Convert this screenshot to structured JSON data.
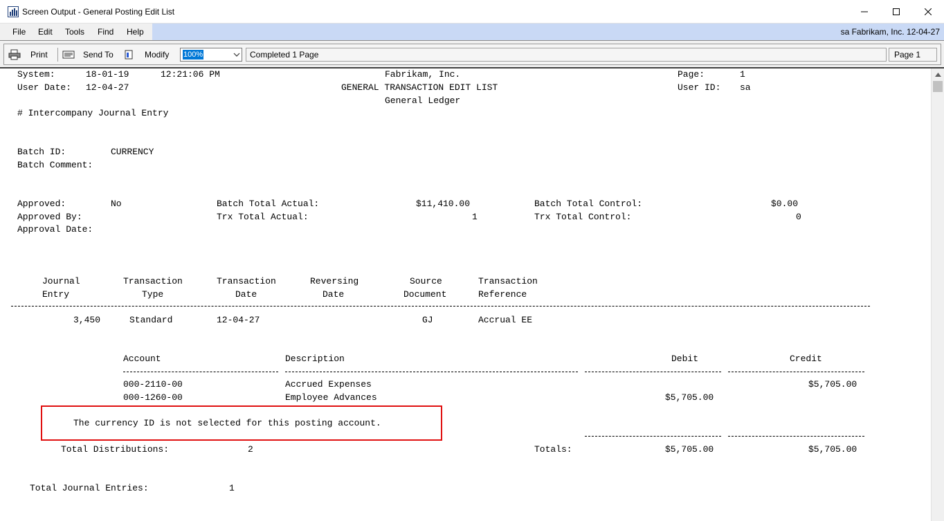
{
  "window": {
    "title": "Screen Output - General Posting Edit List"
  },
  "menu": {
    "items": [
      "File",
      "Edit",
      "Tools",
      "Find",
      "Help"
    ],
    "status": "sa  Fabrikam, Inc.  12-04-27"
  },
  "toolbar": {
    "print": "Print",
    "send_to": "Send To",
    "modify": "Modify",
    "zoom": "100%",
    "status": "Completed 1 Page",
    "page": "Page 1"
  },
  "report": {
    "system_label": "System:",
    "system_date": "18-01-19",
    "system_time": "12:21:06 PM",
    "company": "Fabrikam, Inc.",
    "page_label": "Page:",
    "page_value": "1",
    "user_date_label": "User Date:",
    "user_date": "12-04-27",
    "report_title": "GENERAL TRANSACTION EDIT LIST",
    "user_id_label": "User ID:",
    "user_id": "sa",
    "subtitle": "General Ledger",
    "section_title": "# Intercompany Journal Entry",
    "batch_id_label": "Batch ID:",
    "batch_id": "CURRENCY",
    "batch_comment_label": "Batch Comment:",
    "approved_label": "Approved:",
    "approved": "No",
    "approved_by_label": "Approved By:",
    "approval_date_label": "Approval Date:",
    "batch_total_actual_label": "Batch Total Actual:",
    "batch_total_actual": "$11,410.00",
    "trx_total_actual_label": "Trx Total Actual:",
    "trx_total_actual": "1",
    "batch_total_control_label": "Batch Total Control:",
    "batch_total_control": "$0.00",
    "trx_total_control_label": "Trx Total Control:",
    "trx_total_control": "0",
    "headers": {
      "journal_1": "Journal",
      "journal_2": "Entry",
      "trx_type_1": "Transaction",
      "trx_type_2": "Type",
      "trx_date_1": "Transaction",
      "trx_date_2": "Date",
      "rev_date_1": "Reversing",
      "rev_date_2": "Date",
      "source_1": "Source",
      "source_2": "Document",
      "trx_ref_1": "Transaction",
      "trx_ref_2": "Reference"
    },
    "entry": {
      "journal_entry": "3,450",
      "type": "Standard",
      "date": "12-04-27",
      "source": "GJ",
      "reference": "Accrual EE"
    },
    "dist_headers": {
      "account": "Account",
      "description": "Description",
      "debit": "Debit",
      "credit": "Credit"
    },
    "distributions": [
      {
        "account": "000-2110-00",
        "description": "Accrued Expenses",
        "debit": "",
        "credit": "$5,705.00"
      },
      {
        "account": "000-1260-00",
        "description": "Employee Advances",
        "debit": "$5,705.00",
        "credit": ""
      }
    ],
    "error_message": "The currency ID is not selected for this posting account.",
    "total_distributions_label": "Total Distributions:",
    "total_distributions": "2",
    "totals_label": "Totals:",
    "total_debit": "$5,705.00",
    "total_credit": "$5,705.00",
    "total_journal_entries_label": "Total Journal Entries:",
    "total_journal_entries": "1"
  },
  "colors": {
    "menubar": "#c9d9f5",
    "error_box": "#e01010",
    "zoom_selection": "#0078d7"
  }
}
